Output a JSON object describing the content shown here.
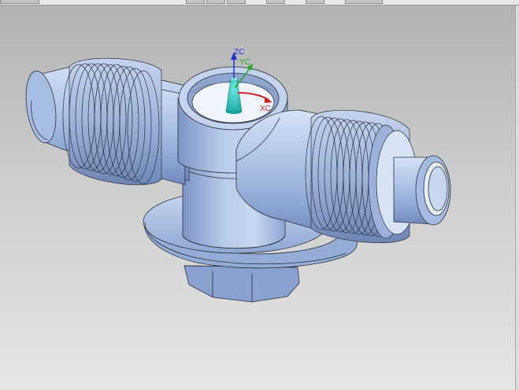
{
  "toolbar": {
    "buttons": [
      "view-fit",
      "view-rotate",
      "view-pan",
      "view-zoom",
      "render-style",
      "render-shaded",
      "render-wire"
    ]
  },
  "viewport": {
    "background_top": "#b3b3b3",
    "background_bottom": "#e6e6e6"
  },
  "triad": {
    "z_label": "ZC",
    "y_label": "YC",
    "x_label": "XC",
    "z_color": "#2233cc",
    "y_color": "#22aa22",
    "x_color": "#cc2222"
  },
  "part": {
    "body_color": "#a9bfe6",
    "edge_color": "#2a2f3a"
  }
}
